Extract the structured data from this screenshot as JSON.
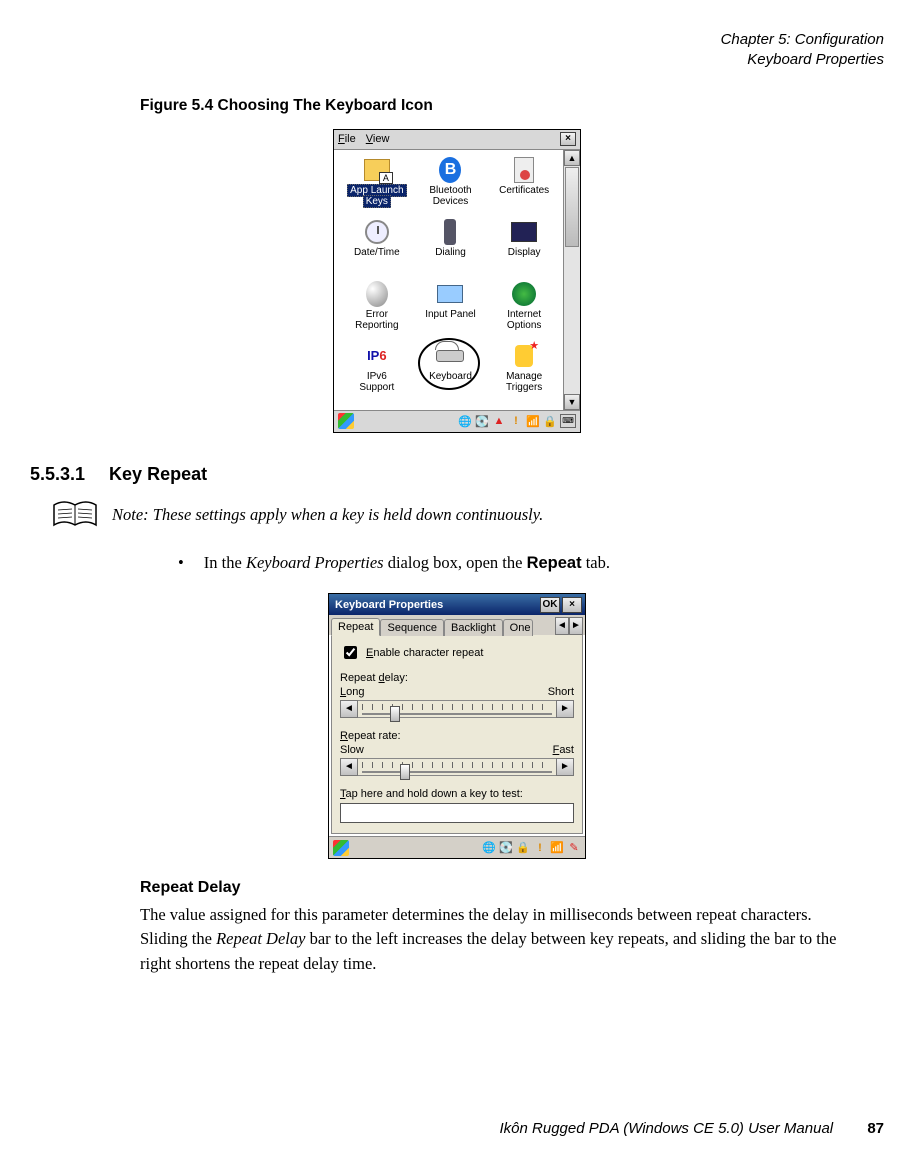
{
  "header": {
    "line1": "Chapter 5: Configuration",
    "line2": "Keyboard Properties"
  },
  "figure_caption": "Figure 5.4  Choosing The Keyboard Icon",
  "cp_window": {
    "menu_file": "File",
    "menu_view": "View",
    "close_x": "×",
    "scroll_up": "▲",
    "scroll_down": "▼",
    "items": [
      {
        "label": "App Launch\nKeys",
        "selected": true
      },
      {
        "label": "Bluetooth\nDevices"
      },
      {
        "label": "Certificates"
      },
      {
        "label": "Date/Time"
      },
      {
        "label": "Dialing"
      },
      {
        "label": "Display"
      },
      {
        "label": "Error\nReporting"
      },
      {
        "label": "Input Panel"
      },
      {
        "label": "Internet\nOptions"
      },
      {
        "label": "IPv6\nSupport",
        "ipv6": true
      },
      {
        "label": "Keyboard",
        "circled": true
      },
      {
        "label": "Manage\nTriggers"
      }
    ]
  },
  "section": {
    "number": "5.5.3.1",
    "title": "Key Repeat"
  },
  "note_text": "Note: These settings apply when a key is held down continuously.",
  "bullet": {
    "pre": "In the ",
    "italic": "Keyboard Properties",
    "mid": " dialog box, open the ",
    "bold": "Repeat",
    "post": " tab."
  },
  "kp_window": {
    "title": "Keyboard Properties",
    "ok": "OK",
    "close": "×",
    "tabs": [
      "Repeat",
      "Sequence",
      "Backlight",
      "One"
    ],
    "tab_left": "◄",
    "tab_right": "►",
    "enable_label": "Enable character repeat",
    "enable_checked": true,
    "delay_label": "Repeat delay:",
    "delay_left": "Long",
    "delay_right": "Short",
    "rate_label": "Repeat rate:",
    "rate_left": "Slow",
    "rate_right": "Fast",
    "slider_left": "◄",
    "slider_right": "►",
    "test_label": "Tap here and hold down a key to test:",
    "underlines": {
      "enable": "E",
      "delay": "d",
      "rate": "R",
      "test": "T",
      "long": "L",
      "fast": "F"
    }
  },
  "subheading": "Repeat Delay",
  "body": {
    "p1a": "The value assigned for this parameter determines the delay in milliseconds between repeat characters. Sliding the ",
    "p1i": "Repeat Delay",
    "p1b": " bar to the left increases the delay between key repeats, and sliding the bar to the right shortens the repeat delay time."
  },
  "footer": {
    "text": "Ikôn Rugged PDA (Windows CE 5.0) User Manual",
    "page": "87"
  }
}
